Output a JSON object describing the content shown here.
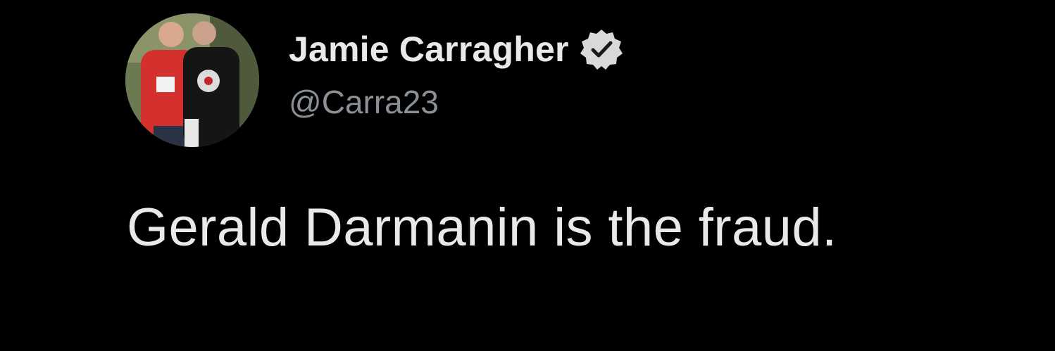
{
  "tweet": {
    "author": {
      "display_name": "Jamie Carragher",
      "handle": "@Carra23",
      "verified": true,
      "avatar_icon": "profile-photo"
    },
    "text": "Gerald Darmanin is the fraud."
  },
  "colors": {
    "background": "#000000",
    "primary_text": "#e7e9ea",
    "secondary_text": "#8b9096",
    "verified_badge": "#d9d9d9"
  }
}
